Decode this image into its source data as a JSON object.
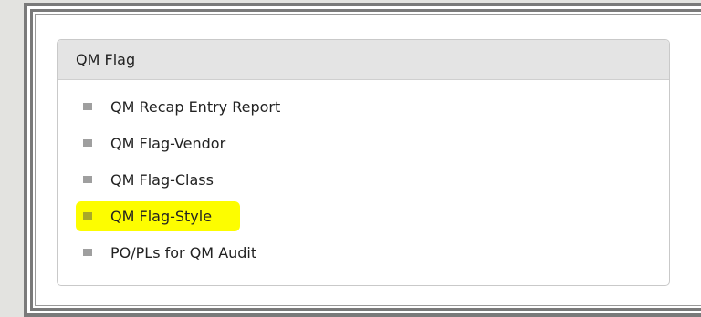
{
  "panel": {
    "title": "QM Flag",
    "items": [
      {
        "label": "QM Recap Entry Report",
        "highlighted": false
      },
      {
        "label": "QM Flag-Vendor",
        "highlighted": false
      },
      {
        "label": "QM Flag-Class",
        "highlighted": false
      },
      {
        "label": "QM Flag-Style",
        "highlighted": true
      },
      {
        "label": "PO/PLs for QM Audit",
        "highlighted": false
      }
    ]
  },
  "colors": {
    "highlight": "#fdfd00",
    "header_bg": "#e4e4e4",
    "bullet": "#9f9f9f"
  },
  "icons": {
    "bullet": "square-bullet-icon"
  }
}
